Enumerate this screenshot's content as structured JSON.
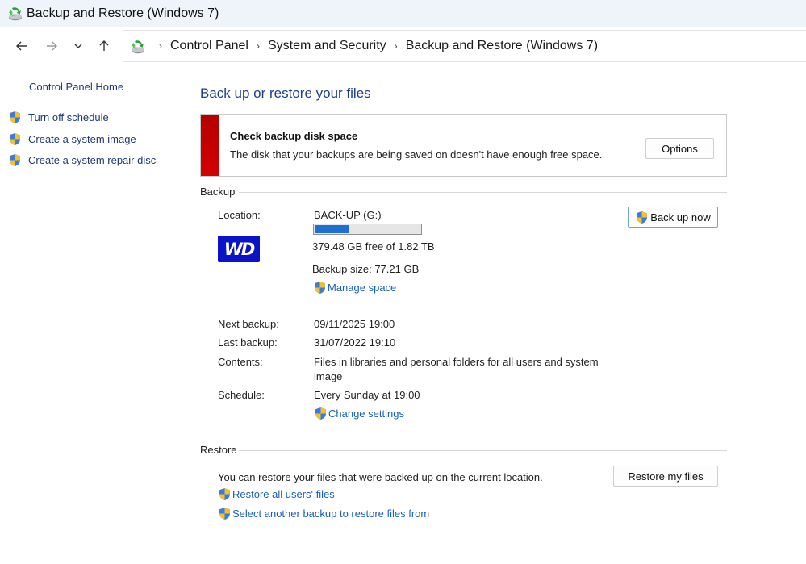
{
  "window": {
    "title": "Backup and Restore (Windows 7)"
  },
  "breadcrumb": [
    "Control Panel",
    "System and Security",
    "Backup and Restore (Windows 7)"
  ],
  "sidebar": {
    "home": "Control Panel Home",
    "items": [
      {
        "label": "Turn off schedule",
        "icon": "shield-icon"
      },
      {
        "label": "Create a system image",
        "icon": "shield-icon"
      },
      {
        "label": "Create a system repair disc",
        "icon": "shield-icon"
      }
    ]
  },
  "main": {
    "title": "Back up or restore your files",
    "alert": {
      "title": "Check backup disk space",
      "text": "The disk that your backups are being saved on doesn't have enough free space.",
      "button": "Options",
      "color": "#c80000"
    },
    "backup": {
      "heading": "Backup",
      "location_label": "Location:",
      "location_value": "BACK-UP (G:)",
      "disk_used_fraction": 0.33,
      "free_text": "379.48 GB free of 1.82 TB",
      "size_text": "Backup size: 77.21 GB",
      "manage_link": "Manage space",
      "button": "Back up now",
      "next_label": "Next backup:",
      "next_value": "09/11/2025 19:00",
      "last_label": "Last backup:",
      "last_value": "31/07/2022 19:10",
      "contents_label": "Contents:",
      "contents_line1": "Files in libraries and personal folders for all users and system",
      "contents_line2": "image",
      "schedule_label": "Schedule:",
      "schedule_value": "Every Sunday at 19:00",
      "change_link": "Change settings",
      "logo_text": "WD"
    },
    "restore": {
      "heading": "Restore",
      "text": "You can restore your files that were backed up on the current location.",
      "button": "Restore my files",
      "link1": "Restore all users' files",
      "link2": "Select another backup to restore files from"
    }
  },
  "colors": {
    "link": "#1a5fb4",
    "title": "#1e3f8a",
    "progress": "#1d6fd2"
  }
}
